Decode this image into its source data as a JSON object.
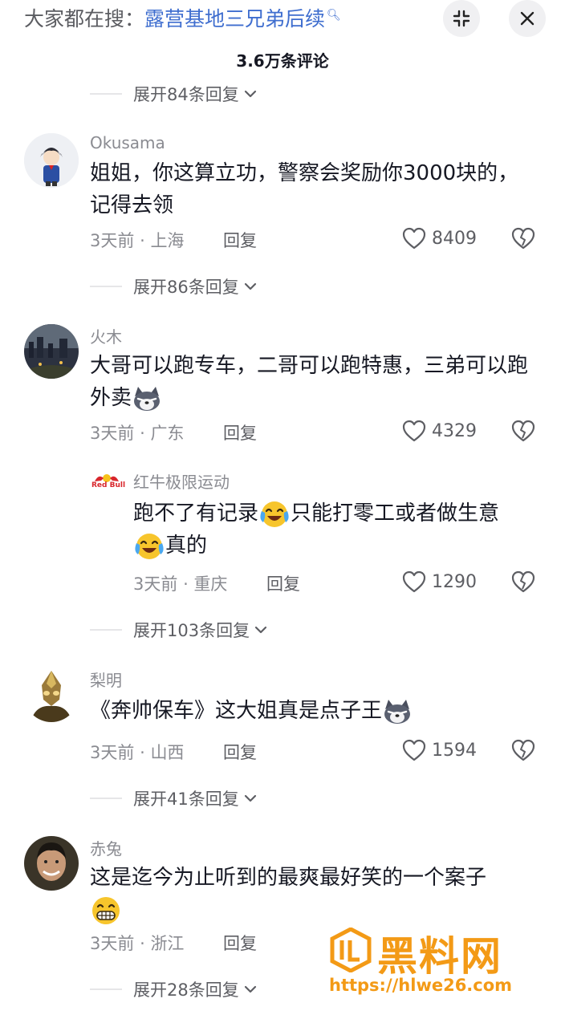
{
  "header": {
    "search_prefix": "大家都在搜：",
    "search_term": "露营基地三兄弟后续",
    "comment_count": "3.6万条评论"
  },
  "top_expand": "展开84条回复",
  "comments": [
    {
      "name": "Okusama",
      "text": "姐姐，你这算立功，警察会奖励你3000块的，记得去领",
      "time": "3天前",
      "location": "上海",
      "reply": "回复",
      "likes": "8409",
      "expand": "展开86条回复"
    },
    {
      "name": "火木",
      "text": "大哥可以跑专车，二哥可以跑特惠，三弟可以跑外卖",
      "time": "3天前",
      "location": "广东",
      "reply": "回复",
      "likes": "4329"
    },
    {
      "name": "红牛极限运动",
      "text_1": "跑不了有记录",
      "text_2": "只能打零工或者做生意",
      "text_3": "真的",
      "time": "3天前",
      "location": "重庆",
      "reply": "回复",
      "likes": "1290",
      "expand": "展开103条回复",
      "logo_text": "Red Bull"
    },
    {
      "name": "梨明",
      "text": "《奔帅保车》这大姐真是点子王",
      "time": "3天前",
      "location": "山西",
      "reply": "回复",
      "likes": "1594",
      "expand": "展开41条回复"
    },
    {
      "name": "赤兔",
      "text": "这是迄今为止听到的最爽最好笑的一个案子",
      "time": "3天前",
      "location": "浙江",
      "reply": "回复",
      "expand": "展开28条回复"
    }
  ],
  "meta_separator": "·",
  "watermark": {
    "title": "黑料网",
    "url": "https://hlwe26.com"
  },
  "colors": {
    "search_term": "#3f6ecf",
    "muted_text": "#8a8b91",
    "watermark": "#f39a16"
  }
}
